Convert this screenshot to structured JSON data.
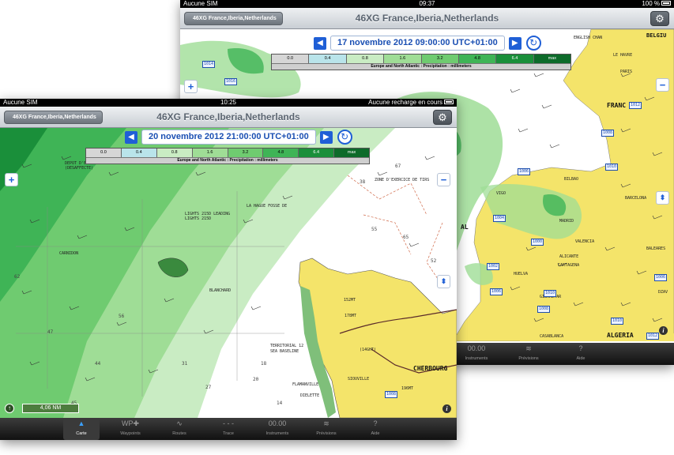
{
  "back_screen": {
    "status": {
      "carrier": "Aucune SIM",
      "time": "09:37",
      "battery": "100 %"
    },
    "nav": {
      "back_label": "46XG France,Iberia,Netherlands",
      "title": "46XG France,Iberia,Netherlands"
    },
    "date": "17 novembre 2012 09:00:00 UTC+01:00",
    "legend": {
      "cells": [
        "0.0",
        "0.4",
        "0.8",
        "1.6",
        "3.2",
        "4.8",
        "6.4",
        "max"
      ],
      "caption": "Europe and North Atlantic : Precipitation : millimeters"
    },
    "place_labels": [
      "BELGIU",
      "ENGLISH CHAN",
      "LE HAVRE",
      "PARIS",
      "FRANC",
      "BILBAO",
      "VIGO",
      "BARCELONA",
      "MADRID",
      "VALENCIA",
      "ALICANTE",
      "CARTAGENA",
      "GIBRALTAR",
      "BALEARES",
      "ALGERIA",
      "CASABLANCA",
      "AL",
      "HUELVA",
      "DZAV"
    ],
    "depth_labels": [
      "1014",
      "1016",
      "1012",
      "1008",
      "1010",
      "1006",
      "1004",
      "1000",
      "1002",
      "1006",
      "1010",
      "1008",
      "1010",
      "1006",
      "1012",
      "1006",
      "1012",
      "1006"
    ],
    "tabs": [
      {
        "icon": "00.00",
        "label": "Instruments"
      },
      {
        "icon": "≋",
        "label": "Prévisions"
      },
      {
        "icon": "?",
        "label": "Aide"
      }
    ]
  },
  "front_screen": {
    "status": {
      "carrier": "Aucune SIM",
      "time": "10:25",
      "battery": "Aucune recharge en cours"
    },
    "nav": {
      "back_label": "46XG France,Iberia,Netherlands",
      "title": "46XG France,Iberia,Netherlands"
    },
    "date": "20 novembre 2012 21:00:00 UTC+01:00",
    "legend": {
      "cells": [
        "0.0",
        "0.4",
        "0.8",
        "1.6",
        "3.2",
        "4.8",
        "6.4",
        "max"
      ],
      "caption": "Europe and North Atlantic : Precipitation : millimeters"
    },
    "scale": "4,06 NM",
    "chart_labels": [
      "ZONE D'EXERCICE DE TIRS",
      "LIGHTS 215D LEADING LIGHTS 215D",
      "LA HAGUE FOSSE DE",
      "CHERBOURG",
      "TERRITORIAL 12",
      "SEA BASELINE",
      "FLAMANVILLE",
      "DIELETTE",
      "SIOUVILLE",
      "CARNIDON",
      "BLANCHARD",
      "DEPOT D'EXPLOSIFS (DESAFFECTE)",
      "152MT",
      "178MT",
      "196MT",
      "(14GHT)"
    ],
    "depth_box": "1008",
    "tabs": [
      {
        "icon": "▲",
        "label": "Carte"
      },
      {
        "icon": "WP✚",
        "label": "Waypoints"
      },
      {
        "icon": "∿",
        "label": "Routes"
      },
      {
        "icon": "- - -",
        "label": "Trace"
      },
      {
        "icon": "00.00",
        "label": "Instruments"
      },
      {
        "icon": "≋",
        "label": "Prévisions"
      },
      {
        "icon": "?",
        "label": "Aide"
      }
    ]
  },
  "colors": {
    "legend": [
      "#d6d6d6",
      "#b9e4ea",
      "#c9ecc3",
      "#9fdd96",
      "#6fcb70",
      "#3fb456",
      "#1a8f3a",
      "#0d6b2a"
    ],
    "land": "#f4e46a",
    "sea": "#ffffff",
    "accent": "#1f5fd6"
  }
}
